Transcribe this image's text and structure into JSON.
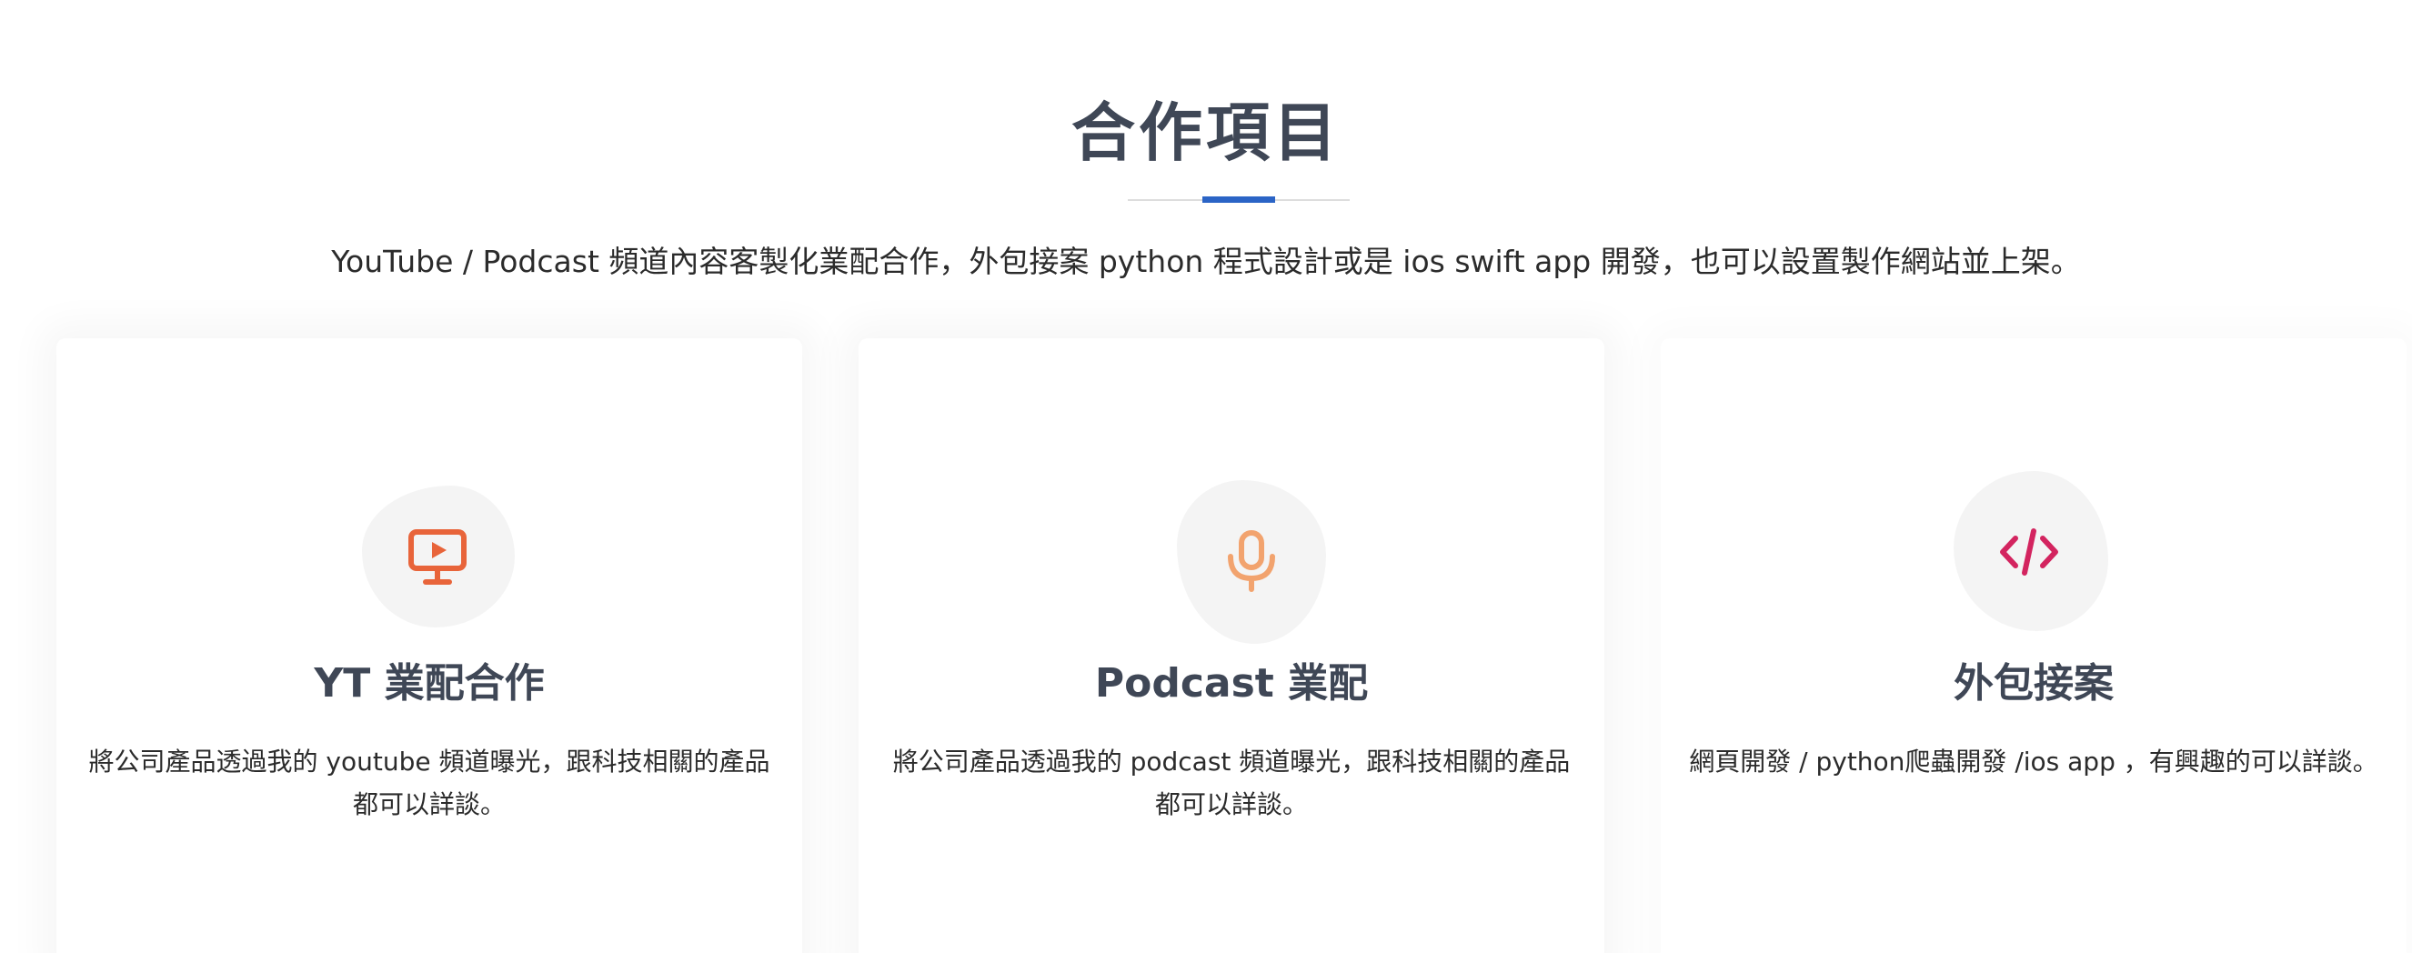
{
  "section": {
    "title": "合作項目",
    "description": "YouTube / Podcast 頻道內容客製化業配合作，外包接案 python 程式設計或是 ios swift app 開發，也可以設置製作網站並上架。"
  },
  "colors": {
    "title": "#3f4756",
    "accent": "#2b64c6",
    "blob": "#f4f4f4"
  },
  "cards": [
    {
      "icon": "monitor-play-icon",
      "icon_color": "#e8643a",
      "title": "YT 業配合作",
      "text": "將公司產品透過我的 youtube 頻道曝光，跟科技相關的產品都可以詳談。"
    },
    {
      "icon": "microphone-icon",
      "icon_color": "#f2a36e",
      "title": "Podcast 業配",
      "text": "將公司產品透過我的 podcast 頻道曝光，跟科技相關的產品都可以詳談。"
    },
    {
      "icon": "code-icon",
      "icon_color": "#d3245f",
      "title": "外包接案",
      "text": "網頁開發 / python爬蟲開發 /ios app ，有興趣的可以詳談。"
    }
  ]
}
